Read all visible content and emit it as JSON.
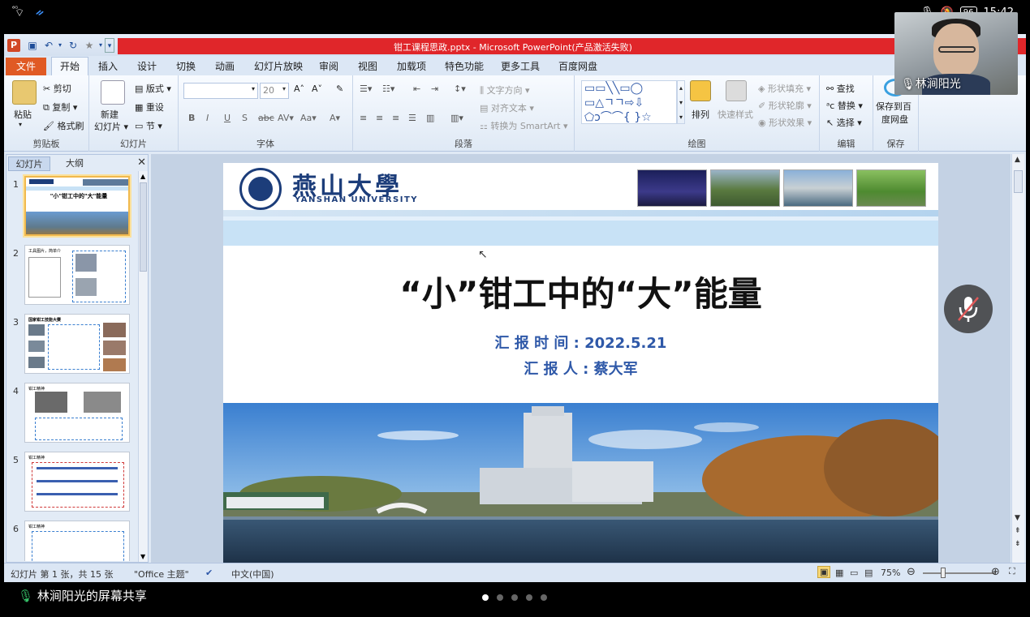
{
  "status_bar": {
    "signal": "⁶ᴳ",
    "time": "15:42",
    "battery": "96"
  },
  "window": {
    "title": "钳工课程思政.pptx  -  Microsoft PowerPoint(产品激活失败)"
  },
  "menu_tabs": [
    "文件",
    "开始",
    "插入",
    "设计",
    "切换",
    "动画",
    "幻灯片放映",
    "审阅",
    "视图",
    "加载项",
    "特色功能",
    "更多工具",
    "百度网盘"
  ],
  "ribbon": {
    "clipboard": {
      "paste": "粘贴",
      "cut": "剪切",
      "copy": "复制",
      "format_painter": "格式刷",
      "label": "剪贴板"
    },
    "slides": {
      "new_slide": "新建",
      "new_slide2": "幻灯片",
      "layout": "版式",
      "reset": "重设",
      "section": "节",
      "label": "幻灯片"
    },
    "font": {
      "size": "20",
      "label": "字体"
    },
    "paragraph": {
      "text_direction": "文字方向",
      "align_text": "对齐文本",
      "smartart": "转换为 SmartArt",
      "label": "段落"
    },
    "drawing": {
      "arrange": "排列",
      "quick_styles": "快速样式",
      "shape_fill": "形状填充",
      "shape_outline": "形状轮廓",
      "shape_effects": "形状效果",
      "label": "绘图"
    },
    "editing": {
      "find": "查找",
      "replace": "替换",
      "select": "选择",
      "label": "编辑"
    },
    "save": {
      "save_baidu": "保存到百",
      "save_baidu2": "度网盘",
      "label": "保存"
    }
  },
  "panel": {
    "tab_slides": "幻灯片",
    "tab_outline": "大纲",
    "thumbnails": [
      {
        "num": "1",
        "title": "\"小\"钳工中的\"大\"能量"
      },
      {
        "num": "2",
        "title": "工具图片，简单介"
      },
      {
        "num": "3",
        "title": "国家钳工技能大赛"
      },
      {
        "num": "4",
        "title": "钳工精神"
      },
      {
        "num": "5",
        "title": "钳工精神"
      },
      {
        "num": "6",
        "title": "钳工精神"
      }
    ]
  },
  "slide": {
    "university_cn": "燕山大學",
    "university_en": "YANSHAN UNIVERSITY",
    "title": "“小”钳工中的“大”能量",
    "report_time": "汇 报 时 间 : 2022.5.21",
    "reporter": "汇   报   人 :   蔡大军"
  },
  "ppt_status": {
    "slide_info": "幻灯片 第 1 张，共 15 张",
    "theme": "\"Office 主题\"",
    "language": "中文(中国)",
    "zoom": "75%"
  },
  "meeting": {
    "participant_name": "林涧阳光",
    "share_label": "林涧阳光的屏幕共享"
  },
  "colors": {
    "title_red": "#e0262a",
    "file_tab": "#e05a24",
    "accent_blue": "#2e58a8"
  }
}
